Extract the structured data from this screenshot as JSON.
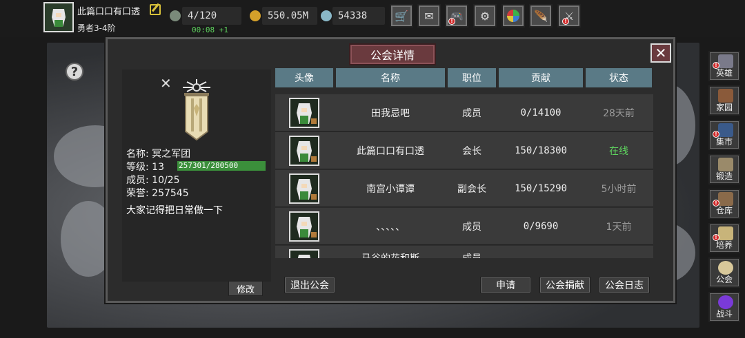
{
  "player": {
    "name": "此篇口口有口透",
    "rank": "勇者3-4阶"
  },
  "stats": {
    "stamina": "4/120",
    "stamina_timer": "00:08 +1",
    "gold": "550.05M",
    "gems": "54338"
  },
  "toolbar": [
    "shop-cart-icon",
    "mail-icon",
    "gamepad-icon",
    "settings-gear-icon",
    "color-wheel-icon",
    "feather-icon",
    "crossed-swords-icon"
  ],
  "sidebar": [
    {
      "label": "英雄",
      "icon": "helmet-icon",
      "badge": true
    },
    {
      "label": "家园",
      "icon": "house-icon",
      "badge": false
    },
    {
      "label": "集市",
      "icon": "market-icon",
      "badge": true
    },
    {
      "label": "锻造",
      "icon": "anvil-icon",
      "badge": false
    },
    {
      "label": "仓库",
      "icon": "chest-icon",
      "badge": true
    },
    {
      "label": "培养",
      "icon": "potion-icon",
      "badge": true
    },
    {
      "label": "公会",
      "icon": "guild-icon",
      "badge": false
    },
    {
      "label": "战斗",
      "icon": "portal-icon",
      "badge": false
    }
  ],
  "dialog": {
    "title": "公会详情",
    "info": {
      "name_label": "名称:",
      "name": "冥之军团",
      "level_label": "等级:",
      "level": "13",
      "exp": "257301/280500",
      "exp_fraction": 0.917,
      "members_label": "成员:",
      "members": "10/25",
      "honor_label": "荣誉:",
      "honor": "257545",
      "notice": "大家记得把日常做一下",
      "modify": "修改"
    },
    "columns": [
      "头像",
      "名称",
      "职位",
      "贡献",
      "状态"
    ],
    "rows": [
      {
        "name": "田我忌吧",
        "role": "成员",
        "contrib": "0/14100",
        "status": "28天前",
        "online": false
      },
      {
        "name": "此篇口口有口透",
        "role": "会长",
        "contrib": "150/18300",
        "status": "在线",
        "online": true
      },
      {
        "name": "南宫小谭谭",
        "role": "副会长",
        "contrib": "150/15290",
        "status": "5小时前",
        "online": false
      },
      {
        "name": "、、、、、",
        "role": "成员",
        "contrib": "0/9690",
        "status": "1天前",
        "online": false
      },
      {
        "name": "马谷的花和斯",
        "role": "成员",
        "contrib": "",
        "status": "",
        "online": false
      }
    ],
    "buttons": {
      "quit": "退出公会",
      "apply": "申请",
      "donate": "公会捐献",
      "log": "公会日志"
    }
  }
}
